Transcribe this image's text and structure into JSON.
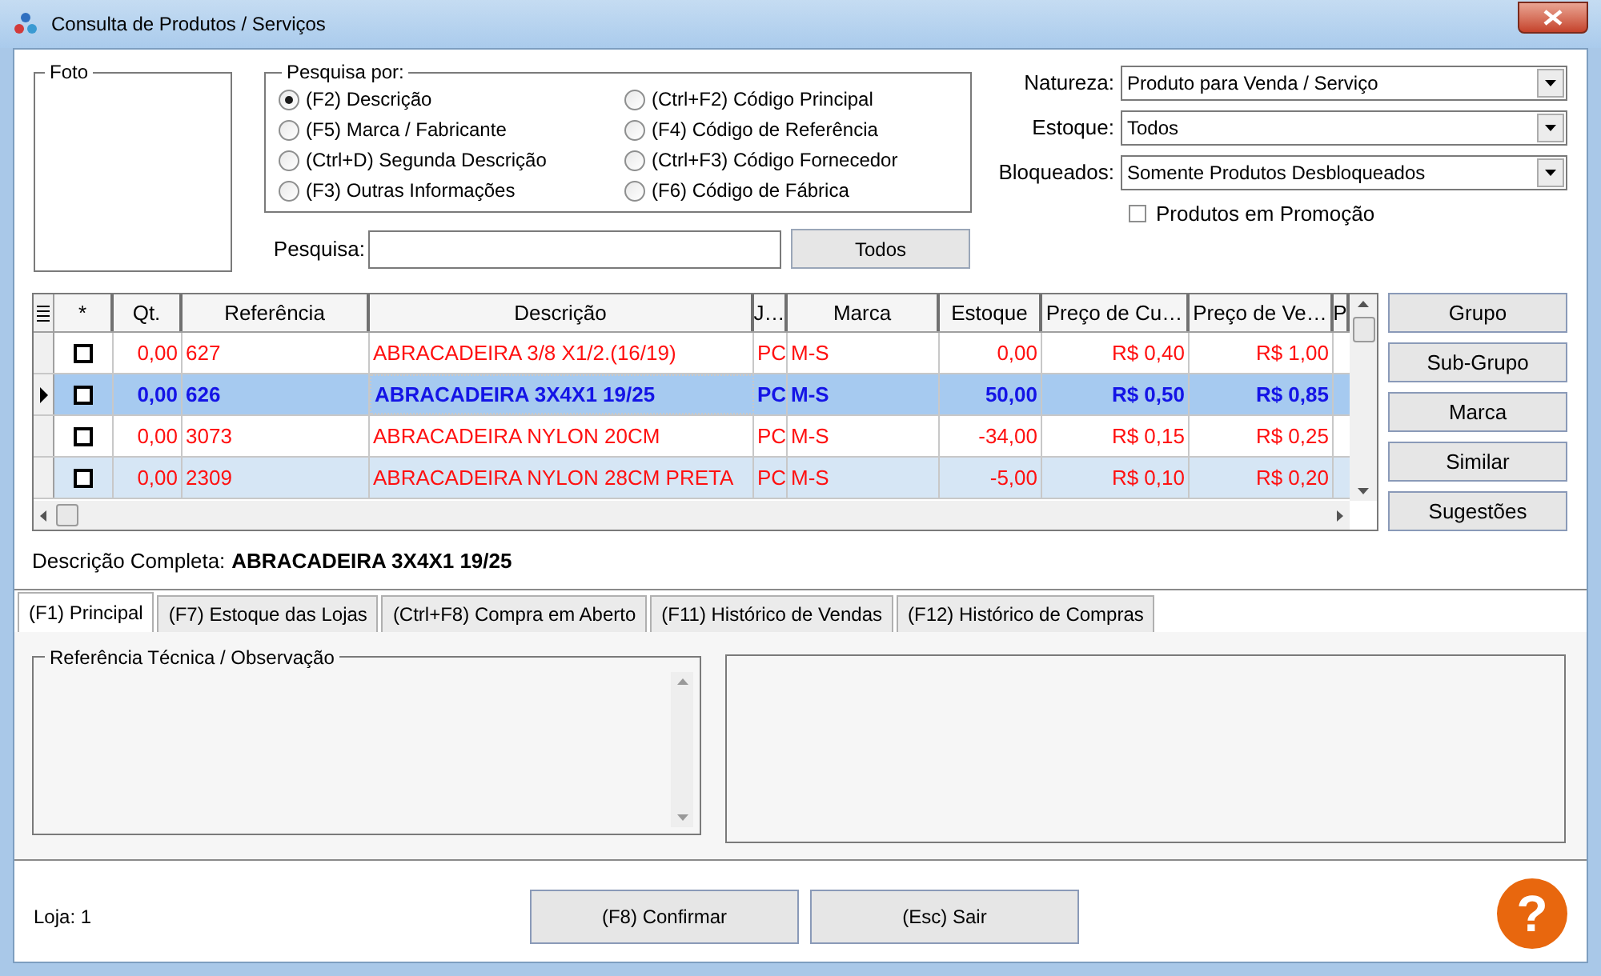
{
  "window": {
    "title": "Consulta de Produtos / Serviços"
  },
  "photo_group": {
    "label": "Foto"
  },
  "search_by": {
    "label": "Pesquisa por:",
    "options": [
      {
        "label": "(F2) Descrição",
        "selected": true
      },
      {
        "label": "(F5) Marca / Fabricante",
        "selected": false
      },
      {
        "label": "(Ctrl+D) Segunda Descrição",
        "selected": false
      },
      {
        "label": "(F3) Outras Informações",
        "selected": false
      },
      {
        "label": "(Ctrl+F2) Código Principal",
        "selected": false
      },
      {
        "label": "(F4) Código de Referência",
        "selected": false
      },
      {
        "label": "(Ctrl+F3) Código Fornecedor",
        "selected": false
      },
      {
        "label": "(F6) Código de Fábrica",
        "selected": false
      }
    ]
  },
  "search": {
    "label": "Pesquisa:",
    "button": "Todos"
  },
  "filters": [
    {
      "label": "Natureza:",
      "value": "Produto para Venda / Serviço"
    },
    {
      "label": "Estoque:",
      "value": "Todos"
    },
    {
      "label": "Bloqueados:",
      "value": "Somente Produtos Desbloqueados"
    }
  ],
  "promo_checkbox": {
    "label": "Produtos em Promoção",
    "checked": false
  },
  "grid": {
    "columns": [
      "*",
      "Qt.",
      "Referência",
      "Descrição",
      "J…",
      "Marca",
      "Estoque",
      "Preço de Cu…",
      "Preço de Ve…",
      "P"
    ],
    "rows": [
      {
        "checked": false,
        "selected": false,
        "cells": [
          "",
          "0,00",
          "627",
          "ABRACADEIRA 3/8 X1/2.(16/19)",
          "PC",
          "M-S",
          "0,00",
          "R$ 0,40",
          "R$ 1,00"
        ]
      },
      {
        "checked": false,
        "selected": true,
        "cells": [
          "",
          "0,00",
          "626",
          "ABRACADEIRA 3X4X1 19/25",
          "PC",
          "M-S",
          "50,00",
          "R$ 0,50",
          "R$ 0,85"
        ]
      },
      {
        "checked": false,
        "selected": false,
        "cells": [
          "",
          "0,00",
          "3073",
          "ABRACADEIRA NYLON 20CM",
          "PC",
          "M-S",
          "-34,00",
          "R$ 0,15",
          "R$ 0,25"
        ]
      },
      {
        "checked": false,
        "selected": false,
        "cells": [
          "",
          "0,00",
          "2309",
          "ABRACADEIRA NYLON 28CM PRETA",
          "PC",
          "M-S",
          "-5,00",
          "R$ 0,10",
          "R$ 0,20"
        ]
      }
    ]
  },
  "side_buttons": [
    "Grupo",
    "Sub-Grupo",
    "Marca",
    "Similar",
    "Sugestões"
  ],
  "full_description": {
    "label": "Descrição Completa:",
    "value": "ABRACADEIRA 3X4X1 19/25"
  },
  "tabs": [
    {
      "label": "(F1) Principal",
      "selected": true
    },
    {
      "label": "(F7) Estoque das Lojas",
      "selected": false
    },
    {
      "label": "(Ctrl+F8) Compra em Aberto",
      "selected": false
    },
    {
      "label": "(F11) Histórico de Vendas",
      "selected": false
    },
    {
      "label": "(F12) Histórico de Compras",
      "selected": false
    }
  ],
  "tab_panel": {
    "group_label": "Referência Técnica / Observação"
  },
  "status": {
    "store": "Loja: 1"
  },
  "buttons": [
    "(F8) Confirmar",
    "(Esc) Sair"
  ],
  "help": {
    "icon_text": "?"
  }
}
